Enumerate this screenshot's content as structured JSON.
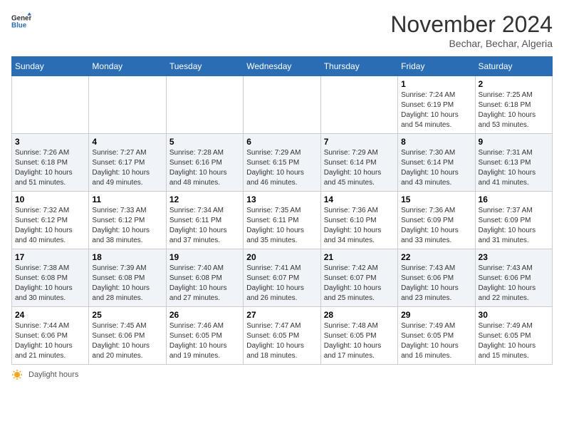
{
  "header": {
    "logo_general": "General",
    "logo_blue": "Blue",
    "month": "November 2024",
    "location": "Bechar, Bechar, Algeria"
  },
  "days_of_week": [
    "Sunday",
    "Monday",
    "Tuesday",
    "Wednesday",
    "Thursday",
    "Friday",
    "Saturday"
  ],
  "weeks": [
    [
      {
        "day": "",
        "info": ""
      },
      {
        "day": "",
        "info": ""
      },
      {
        "day": "",
        "info": ""
      },
      {
        "day": "",
        "info": ""
      },
      {
        "day": "",
        "info": ""
      },
      {
        "day": "1",
        "info": "Sunrise: 7:24 AM\nSunset: 6:19 PM\nDaylight: 10 hours and 54 minutes."
      },
      {
        "day": "2",
        "info": "Sunrise: 7:25 AM\nSunset: 6:18 PM\nDaylight: 10 hours and 53 minutes."
      }
    ],
    [
      {
        "day": "3",
        "info": "Sunrise: 7:26 AM\nSunset: 6:18 PM\nDaylight: 10 hours and 51 minutes."
      },
      {
        "day": "4",
        "info": "Sunrise: 7:27 AM\nSunset: 6:17 PM\nDaylight: 10 hours and 49 minutes."
      },
      {
        "day": "5",
        "info": "Sunrise: 7:28 AM\nSunset: 6:16 PM\nDaylight: 10 hours and 48 minutes."
      },
      {
        "day": "6",
        "info": "Sunrise: 7:29 AM\nSunset: 6:15 PM\nDaylight: 10 hours and 46 minutes."
      },
      {
        "day": "7",
        "info": "Sunrise: 7:29 AM\nSunset: 6:14 PM\nDaylight: 10 hours and 45 minutes."
      },
      {
        "day": "8",
        "info": "Sunrise: 7:30 AM\nSunset: 6:14 PM\nDaylight: 10 hours and 43 minutes."
      },
      {
        "day": "9",
        "info": "Sunrise: 7:31 AM\nSunset: 6:13 PM\nDaylight: 10 hours and 41 minutes."
      }
    ],
    [
      {
        "day": "10",
        "info": "Sunrise: 7:32 AM\nSunset: 6:12 PM\nDaylight: 10 hours and 40 minutes."
      },
      {
        "day": "11",
        "info": "Sunrise: 7:33 AM\nSunset: 6:12 PM\nDaylight: 10 hours and 38 minutes."
      },
      {
        "day": "12",
        "info": "Sunrise: 7:34 AM\nSunset: 6:11 PM\nDaylight: 10 hours and 37 minutes."
      },
      {
        "day": "13",
        "info": "Sunrise: 7:35 AM\nSunset: 6:11 PM\nDaylight: 10 hours and 35 minutes."
      },
      {
        "day": "14",
        "info": "Sunrise: 7:36 AM\nSunset: 6:10 PM\nDaylight: 10 hours and 34 minutes."
      },
      {
        "day": "15",
        "info": "Sunrise: 7:36 AM\nSunset: 6:09 PM\nDaylight: 10 hours and 33 minutes."
      },
      {
        "day": "16",
        "info": "Sunrise: 7:37 AM\nSunset: 6:09 PM\nDaylight: 10 hours and 31 minutes."
      }
    ],
    [
      {
        "day": "17",
        "info": "Sunrise: 7:38 AM\nSunset: 6:08 PM\nDaylight: 10 hours and 30 minutes."
      },
      {
        "day": "18",
        "info": "Sunrise: 7:39 AM\nSunset: 6:08 PM\nDaylight: 10 hours and 28 minutes."
      },
      {
        "day": "19",
        "info": "Sunrise: 7:40 AM\nSunset: 6:08 PM\nDaylight: 10 hours and 27 minutes."
      },
      {
        "day": "20",
        "info": "Sunrise: 7:41 AM\nSunset: 6:07 PM\nDaylight: 10 hours and 26 minutes."
      },
      {
        "day": "21",
        "info": "Sunrise: 7:42 AM\nSunset: 6:07 PM\nDaylight: 10 hours and 25 minutes."
      },
      {
        "day": "22",
        "info": "Sunrise: 7:43 AM\nSunset: 6:06 PM\nDaylight: 10 hours and 23 minutes."
      },
      {
        "day": "23",
        "info": "Sunrise: 7:43 AM\nSunset: 6:06 PM\nDaylight: 10 hours and 22 minutes."
      }
    ],
    [
      {
        "day": "24",
        "info": "Sunrise: 7:44 AM\nSunset: 6:06 PM\nDaylight: 10 hours and 21 minutes."
      },
      {
        "day": "25",
        "info": "Sunrise: 7:45 AM\nSunset: 6:06 PM\nDaylight: 10 hours and 20 minutes."
      },
      {
        "day": "26",
        "info": "Sunrise: 7:46 AM\nSunset: 6:05 PM\nDaylight: 10 hours and 19 minutes."
      },
      {
        "day": "27",
        "info": "Sunrise: 7:47 AM\nSunset: 6:05 PM\nDaylight: 10 hours and 18 minutes."
      },
      {
        "day": "28",
        "info": "Sunrise: 7:48 AM\nSunset: 6:05 PM\nDaylight: 10 hours and 17 minutes."
      },
      {
        "day": "29",
        "info": "Sunrise: 7:49 AM\nSunset: 6:05 PM\nDaylight: 10 hours and 16 minutes."
      },
      {
        "day": "30",
        "info": "Sunrise: 7:49 AM\nSunset: 6:05 PM\nDaylight: 10 hours and 15 minutes."
      }
    ]
  ],
  "legend": {
    "daylight_label": "Daylight hours"
  }
}
